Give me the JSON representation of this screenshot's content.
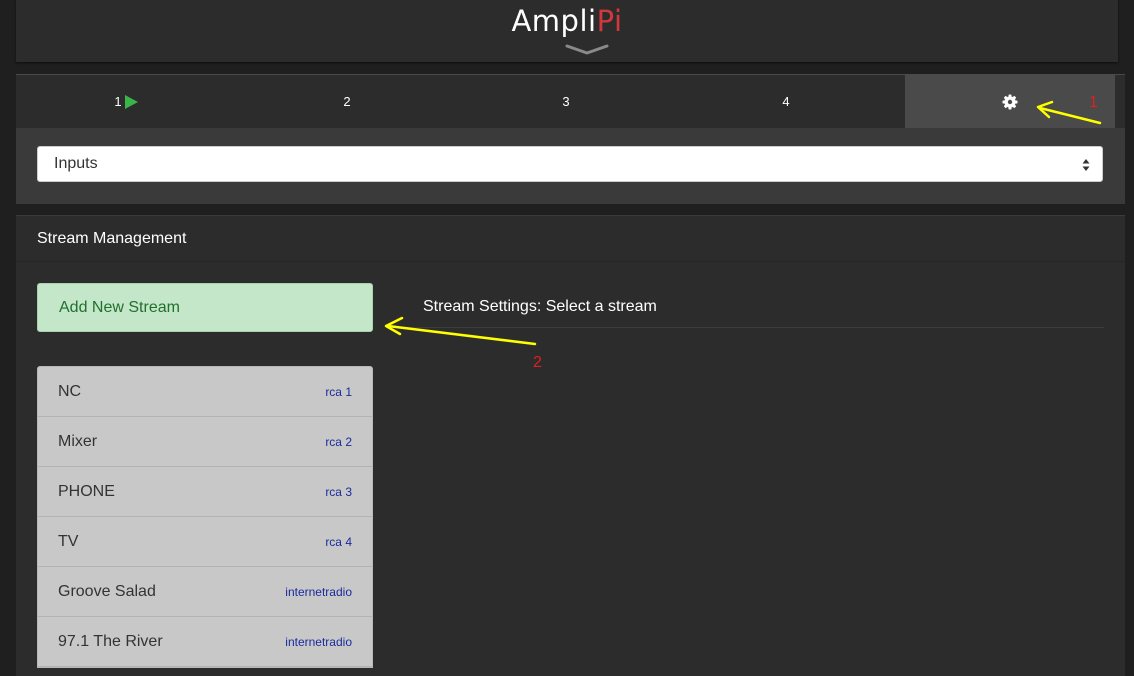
{
  "header": {
    "logo_part1": "Ampli",
    "logo_part2": "Pi",
    "expand_icon": "chevron-down-icon"
  },
  "tabs": [
    {
      "label": "1",
      "playing": true
    },
    {
      "label": "2"
    },
    {
      "label": "3"
    },
    {
      "label": "4"
    },
    {
      "label": "",
      "icon": "gear-icon",
      "active": true
    }
  ],
  "settings_select": {
    "value": "Inputs"
  },
  "stream_management": {
    "title": "Stream Management",
    "add_button_label": "Add New Stream",
    "settings_title": "Stream Settings: Select a stream",
    "streams": [
      {
        "name": "NC",
        "type": "rca 1"
      },
      {
        "name": "Mixer",
        "type": "rca 2"
      },
      {
        "name": "PHONE",
        "type": "rca 3"
      },
      {
        "name": "TV",
        "type": "rca 4"
      },
      {
        "name": "Groove Salad",
        "type": "internetradio"
      },
      {
        "name": "97.1 The River",
        "type": "internetradio"
      }
    ]
  },
  "annotations": {
    "marker_1": "1",
    "marker_2": "2"
  },
  "colors": {
    "logo_accent": "#d0383d",
    "play_icon": "#3ab54a",
    "add_button_bg": "#c4e6c9",
    "stream_type_text": "#1a2b9c",
    "annotation_arrow": "#ffff00",
    "annotation_number": "#e02020"
  }
}
